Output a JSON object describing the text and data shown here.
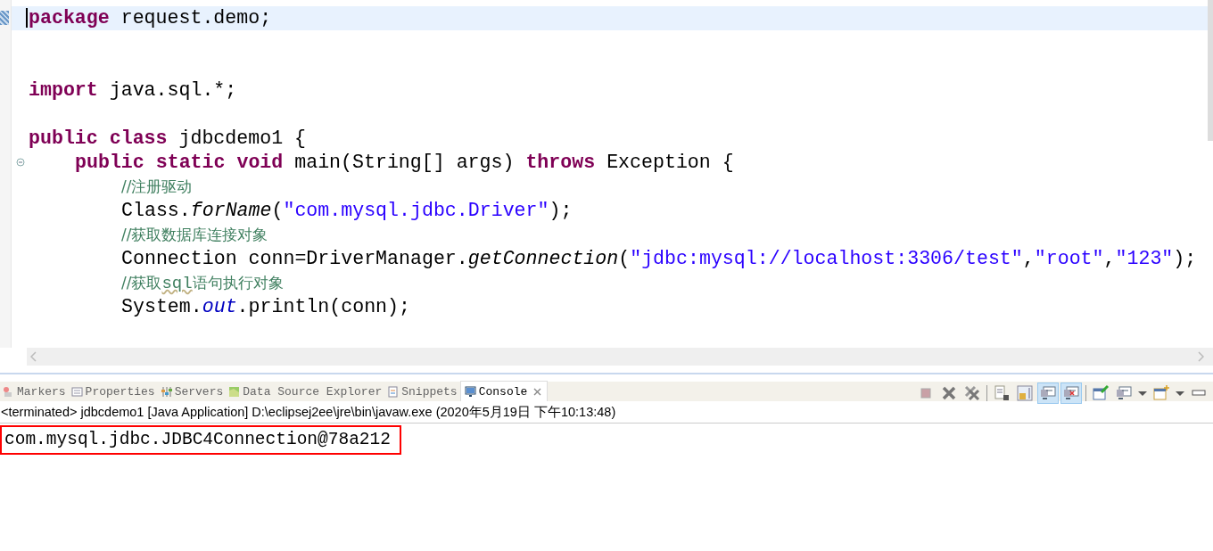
{
  "editor": {
    "lines": [
      {
        "current": true,
        "tokens": [
          {
            "kind": "keyword",
            "text": "package"
          },
          {
            "kind": "plain",
            "text": " request.demo;"
          }
        ]
      },
      {
        "current": false
      },
      {
        "current": false
      },
      {
        "current": false,
        "tokens": [
          {
            "kind": "keyword",
            "text": "import"
          },
          {
            "kind": "plain",
            "text": " java.sql.*;"
          }
        ]
      },
      {
        "current": false
      },
      {
        "current": false,
        "tokens": [
          {
            "kind": "keyword",
            "text": "public class"
          },
          {
            "kind": "plain",
            "text": " jdbcdemo1 {"
          }
        ],
        "children": [
          {
            "current": false,
            "folded": false,
            "tokens": [
              {
                "kind": "keyword",
                "text": "public static void"
              },
              {
                "kind": "plain",
                "text": " main(String[] args) "
              },
              {
                "kind": "keyword",
                "text": "throws"
              },
              {
                "kind": "plain",
                "text": " Exception {"
              }
            ],
            "children": [
              {
                "current": false,
                "tokens": [
                  {
                    "kind": "comment",
                    "text": "//注册驱动"
                  }
                ]
              },
              {
                "current": false,
                "tokens": [
                  {
                    "kind": "plain",
                    "text": "Class."
                  },
                  {
                    "kind": "method",
                    "text": "forName"
                  },
                  {
                    "kind": "plain",
                    "text": "("
                  },
                  {
                    "kind": "string",
                    "text": "\"com.mysql.jdbc.Driver\""
                  },
                  {
                    "kind": "plain",
                    "text": ");"
                  }
                ]
              },
              {
                "current": false,
                "tokens": [
                  {
                    "kind": "comment",
                    "text": "//获取数据库连接对象"
                  }
                ]
              },
              {
                "current": false,
                "tokens": [
                  {
                    "kind": "plain",
                    "text": "Connection conn=DriverManager."
                  },
                  {
                    "kind": "method",
                    "text": "getConnection"
                  },
                  {
                    "kind": "plain",
                    "text": "("
                  },
                  {
                    "kind": "string",
                    "text": "\"jdbc:mysql://localhost:3306/test\""
                  },
                  {
                    "kind": "plain",
                    "text": ","
                  },
                  {
                    "kind": "string",
                    "text": "\"root\""
                  },
                  {
                    "kind": "plain",
                    "text": ","
                  },
                  {
                    "kind": "string",
                    "text": "\"123\""
                  },
                  {
                    "kind": "plain",
                    "text": ");"
                  }
                ]
              },
              {
                "current": false,
                "tokens": [
                  {
                    "kind": "comment",
                    "text": "//获取"
                  },
                  {
                    "kind": "misspelled",
                    "text": "sql"
                  },
                  {
                    "kind": "comment",
                    "text": "语句执行对象"
                  }
                ]
              },
              {
                "current": false,
                "tokens": [
                  {
                    "kind": "plain",
                    "text": "System."
                  },
                  {
                    "kind": "field",
                    "text": "out"
                  },
                  {
                    "kind": "plain",
                    "text": ".println(conn);"
                  }
                ]
              }
            ]
          }
        ]
      }
    ]
  },
  "views": {
    "tabs": [
      {
        "label": "Markers",
        "kind": "markers",
        "selected": false
      },
      {
        "label": "Properties",
        "kind": "properties",
        "selected": false
      },
      {
        "label": "Servers",
        "kind": "servers",
        "selected": false
      },
      {
        "label": "Data Source Explorer",
        "kind": "datasource",
        "selected": false
      },
      {
        "label": "Snippets",
        "kind": "snippets",
        "selected": false
      },
      {
        "label": "Console",
        "kind": "console",
        "selected": true
      }
    ],
    "toolbar": [
      {
        "kind": "terminate",
        "pressed": false
      },
      {
        "kind": "remove",
        "pressed": false
      },
      {
        "kind": "remove-all",
        "pressed": false
      },
      {
        "kind": "sep"
      },
      {
        "kind": "clear",
        "pressed": false
      },
      {
        "kind": "scroll-lock",
        "pressed": false
      },
      {
        "kind": "show-out",
        "pressed": true
      },
      {
        "kind": "show-err",
        "pressed": true
      },
      {
        "kind": "sep"
      },
      {
        "kind": "pin",
        "pressed": false
      },
      {
        "kind": "display",
        "pressed": false
      },
      {
        "kind": "dropdown"
      },
      {
        "kind": "open-console",
        "pressed": false
      },
      {
        "kind": "dropdown"
      },
      {
        "kind": "minimize",
        "pressed": false
      }
    ]
  },
  "console": {
    "header": "<terminated> jdbcdemo1 [Java Application] D:\\eclipsej2ee\\jre\\bin\\javaw.exe (2020年5月19日 下午10:13:48)",
    "output": "com.mysql.jdbc.JDBC4Connection@78a212",
    "highlighted": true
  }
}
